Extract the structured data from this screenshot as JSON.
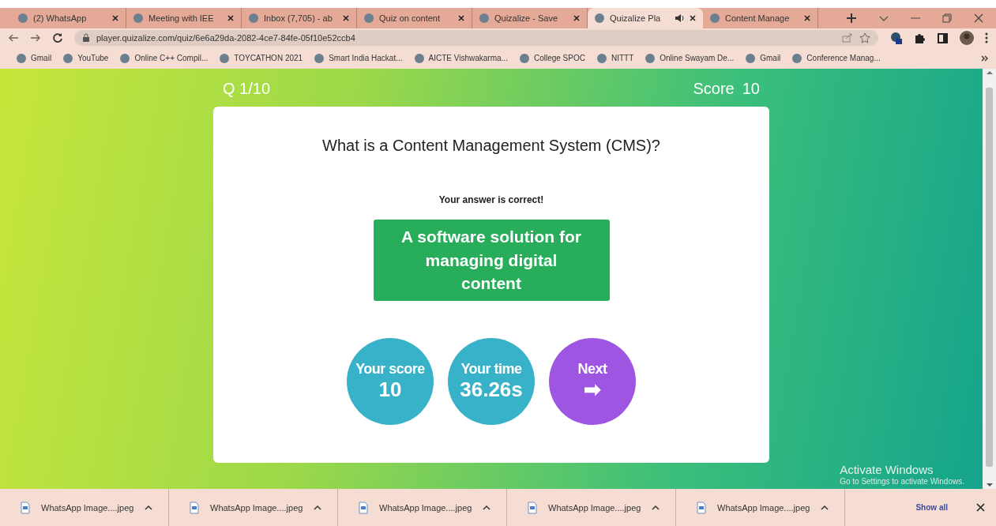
{
  "tabs": [
    {
      "label": "(2) WhatsApp",
      "selected": false,
      "audio": false
    },
    {
      "label": "Meeting with IEE",
      "selected": false,
      "audio": false
    },
    {
      "label": "Inbox (7,705) - ab",
      "selected": false,
      "audio": false
    },
    {
      "label": "Quiz on content",
      "selected": false,
      "audio": false
    },
    {
      "label": "Quizalize - Save",
      "selected": false,
      "audio": false
    },
    {
      "label": "Quizalize Pla",
      "selected": true,
      "audio": true
    },
    {
      "label": "Content Manage",
      "selected": false,
      "audio": false
    }
  ],
  "address_bar": {
    "url": "player.quizalize.com/quiz/6e6a29da-2082-4ce7-84fe-05f10e52ccb4"
  },
  "bookmarks": [
    "Gmail",
    "YouTube",
    "Online C++ Compil...",
    "TOYCATHON 2021",
    "Smart India Hackat...",
    "AICTE Vishwakarma...",
    "College SPOC",
    "NITTT",
    "Online Swayam De...",
    "Gmail",
    "Conference Manag..."
  ],
  "quiz": {
    "question_counter": "Q 1/10",
    "score_label": "Score",
    "score": "10",
    "question": "What is a Content Management System (CMS)?",
    "feedback": "Your answer is correct!",
    "answer": "A software solution for managing digital content",
    "answer_correct": true,
    "stats": [
      {
        "kind": "stat",
        "label": "Your score",
        "value": "10"
      },
      {
        "kind": "stat",
        "label": "Your time",
        "value": "36.26s"
      },
      {
        "kind": "next",
        "label": "Next",
        "value": "➡"
      }
    ]
  },
  "os_notice": {
    "title": "Activate Windows",
    "subtitle": "Go to Settings to activate Windows."
  },
  "downloads": {
    "items": [
      "WhatsApp Image....jpeg",
      "WhatsApp Image....jpeg",
      "WhatsApp Image....jpeg",
      "WhatsApp Image....jpeg",
      "WhatsApp Image....jpeg"
    ],
    "show_all": "Show all"
  }
}
